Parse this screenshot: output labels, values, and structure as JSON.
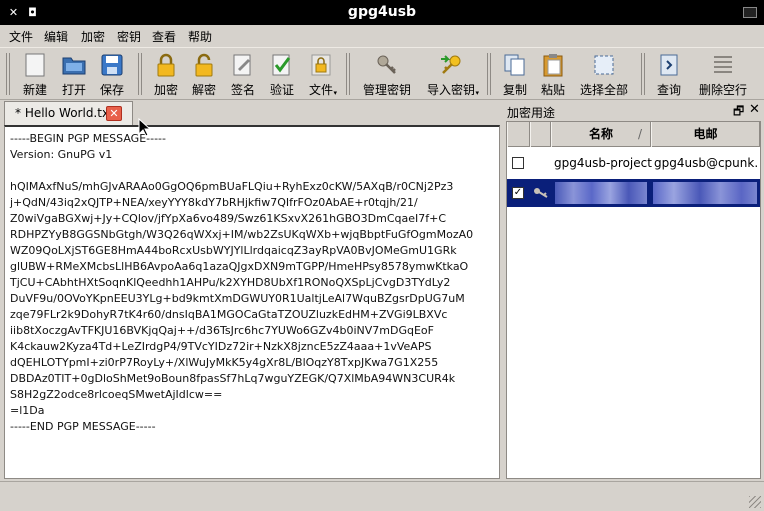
{
  "window": {
    "title": "gpg4usb",
    "close_glyph": "✕",
    "restore_glyph": "◘"
  },
  "menu": [
    "文件",
    "编辑",
    "加密",
    "密钥",
    "查看",
    "帮助"
  ],
  "toolbar": {
    "new": "新建",
    "open": "打开",
    "save": "保存",
    "encrypt": "加密",
    "decrypt": "解密",
    "sign": "签名",
    "verify": "验证",
    "file": "文件",
    "manage_keys": "管理密钥",
    "import_key": "导入密钥",
    "copy": "复制",
    "paste": "粘贴",
    "select_all": "选择全部",
    "find": "查询",
    "delete_empty_lines": "删除空行",
    "dropdown_glyph": "▾"
  },
  "tab": {
    "label": "* Hello World.txt",
    "close_glyph": "✕"
  },
  "editor": {
    "lines": [
      "-----BEGIN PGP MESSAGE-----",
      "Version: GnuPG v1",
      "",
      "hQIMAxfNuS/mhGJvARAAo0GgOQ6pmBUaFLQiu+RyhExz0cKW/5AXqB/r0CNj2Pz3",
      "j+QdN/43iq2xQJTP+NEA/xeyYYY8kdY7bRHjkfiw7QIfrFOz0AbAE+r0tqjh/21/",
      "Z0wiVgaBGXwj+Jy+CQlov/jfYpXa6vo489/Swz61KSxvX261hGBO3DmCqaeI7f+C",
      "RDHPZYyB8GGSNbGtgh/W3Q26qWXxj+IM/wb2ZsUKqWXb+wjqBbptFuGfOgmMozA0",
      "WZ09QoLXjST6GE8HmA44boRcxUsbWYJYlLlrdqaicqZ3ayRpVA0BvJOMeGmU1GRk",
      "glUBW+RMeXMcbsLlHB6AvpoAa6q1azaQJgxDXN9mTGPP/HmeHPsy8578ymwKtkaO",
      "TjCU+CAbhtHXtSoqnKlQeedhh1AHPu/k2XYHD8UbXf1RONoQXSpLjCvgD3TYdLy2",
      "DuVF9u/0OVoYKpnEEU3YLg+bd9kmtXmDGWUY0R1UaltjLeAl7WquBZgsrDpUG7uM",
      "zqe79FLr2k9DohyR7tK4r60/dnsIqBA1MGOCaGtaTZOUZluzkEdHM+ZVGi9LBXVc",
      "iib8tXoczgAvTFKJU16BVKjqQaj++/d36TsJrc6hc7YUWo6GZv4b0iNV7mDGqEoF",
      "K4ckauw2Kyza4Td+LeZIrdgP4/9TVcYIDz72ir+NzkX8jzncE5zZ4aaa+1vVeAPS",
      "dQEHLOTYpmI+zi0rP7RoyLy+/XlWuJyMkK5y4gXr8L/BlOqzY8TxpJKwa7G1X255",
      "DBDAz0TIT+0gDloShMet9oBoun8fpasSf7hLq7wguYZEGK/Q7XlMbA94WN3CUR4k",
      "S8H2gZ2odce8rlcoeqSMwetAjIdlcw==",
      "=l1Da",
      "-----END PGP MESSAGE-----"
    ]
  },
  "key_panel": {
    "title": "加密用途",
    "float_glyph": "🗗",
    "close_glyph": "✕",
    "columns": {
      "name": "名称",
      "email": "电邮",
      "sort_glyph": "/"
    },
    "rows": [
      {
        "checked": false,
        "name": "gpg4usb-project",
        "email": "gpg4usb@cpunk.…"
      },
      {
        "checked": true,
        "check_glyph": "✓",
        "name": "",
        "email": ""
      }
    ]
  },
  "colors": {
    "selection": "#0a1f7a",
    "tab_close": "#e8604a",
    "title_bg": "#000000"
  }
}
